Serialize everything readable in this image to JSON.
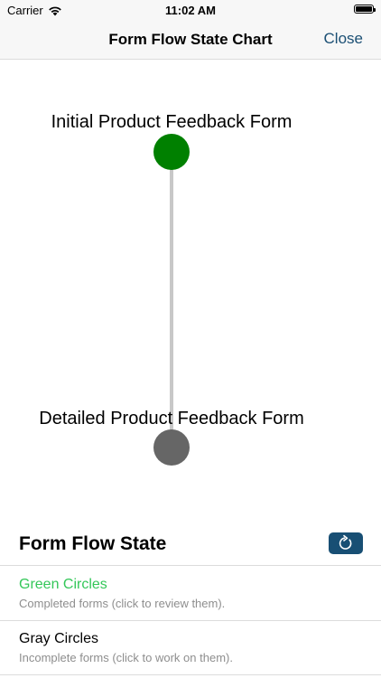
{
  "status_bar": {
    "carrier": "Carrier",
    "time": "11:02 AM"
  },
  "nav": {
    "title": "Form Flow State Chart",
    "close_label": "Close"
  },
  "flow": {
    "nodes": [
      {
        "label": "Initial Product Feedback Form",
        "state": "completed",
        "color": "#008000"
      },
      {
        "label": "Detailed Product Feedback Form",
        "state": "incomplete",
        "color": "#666666"
      }
    ],
    "connector_color": "#c8c8c8"
  },
  "legend": {
    "title": "Form Flow State",
    "items": [
      {
        "title": "Green Circles",
        "description": "Completed forms (click to review them).",
        "color": "#34c759"
      },
      {
        "title": "Gray Circles",
        "description": "Incomplete forms (click to work on them).",
        "color": "#000000"
      }
    ]
  },
  "colors": {
    "accent": "#1b4f74",
    "refresh_button": "#184f74"
  }
}
